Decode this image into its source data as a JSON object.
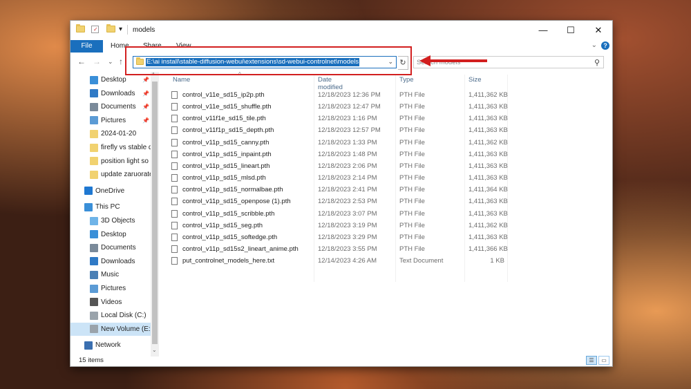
{
  "window": {
    "title": "models",
    "qat_dropdown": "▾",
    "controls": {
      "minimize": "—",
      "maximize": "☐",
      "close": "✕"
    }
  },
  "ribbon": {
    "file_label": "File",
    "tabs": [
      "Home",
      "Share",
      "View"
    ],
    "expand": "⌄",
    "help": "?"
  },
  "nav": {
    "back": "←",
    "forward": "→",
    "recent": "⌄",
    "up": "↑",
    "address": "E:\\ai install\\stable-diffusion-webui\\extensions\\sd-webui-controlnet\\models",
    "address_dropdown": "⌄",
    "refresh": "↻",
    "search_placeholder": "Search models",
    "search_icon": "⚲",
    "collapse": "^"
  },
  "sidebar": {
    "quick_access": [
      {
        "label": "Desktop",
        "icon": "desktop-icon",
        "pinned": true
      },
      {
        "label": "Downloads",
        "icon": "downloads-icon",
        "pinned": true
      },
      {
        "label": "Documents",
        "icon": "documents-icon",
        "pinned": true
      },
      {
        "label": "Pictures",
        "icon": "pictures-icon",
        "pinned": true
      },
      {
        "label": "2024-01-20",
        "icon": "folder-icon",
        "pinned": false
      },
      {
        "label": "firefly vs stable d",
        "icon": "folder-icon",
        "pinned": false
      },
      {
        "label": "position light so",
        "icon": "folder-icon",
        "pinned": false
      },
      {
        "label": "update zaruorate",
        "icon": "folder-icon",
        "pinned": false
      }
    ],
    "pin_glyph": "📌",
    "onedrive": "OneDrive",
    "this_pc": "This PC",
    "pc_items": [
      {
        "label": "3D Objects",
        "icon": "3d-objects-icon"
      },
      {
        "label": "Desktop",
        "icon": "desktop-icon"
      },
      {
        "label": "Documents",
        "icon": "documents-icon"
      },
      {
        "label": "Downloads",
        "icon": "downloads-icon"
      },
      {
        "label": "Music",
        "icon": "music-icon"
      },
      {
        "label": "Pictures",
        "icon": "pictures-icon"
      },
      {
        "label": "Videos",
        "icon": "videos-icon"
      },
      {
        "label": "Local Disk (C:)",
        "icon": "drive-icon"
      },
      {
        "label": "New Volume (E:)",
        "icon": "drive-icon",
        "selected": true
      }
    ],
    "network": "Network",
    "scroll_up": "^",
    "scroll_down": "⌄"
  },
  "list": {
    "columns": [
      "Name",
      "Date modified",
      "Type",
      "Size"
    ],
    "rows": [
      [
        "control_v11e_sd15_ip2p.pth",
        "12/18/2023 12:36 PM",
        "PTH File",
        "1,411,362 KB"
      ],
      [
        "control_v11e_sd15_shuffle.pth",
        "12/18/2023 12:47 PM",
        "PTH File",
        "1,411,363 KB"
      ],
      [
        "control_v11f1e_sd15_tile.pth",
        "12/18/2023 1:16 PM",
        "PTH File",
        "1,411,363 KB"
      ],
      [
        "control_v11f1p_sd15_depth.pth",
        "12/18/2023 12:57 PM",
        "PTH File",
        "1,411,363 KB"
      ],
      [
        "control_v11p_sd15_canny.pth",
        "12/18/2023 1:33 PM",
        "PTH File",
        "1,411,362 KB"
      ],
      [
        "control_v11p_sd15_inpaint.pth",
        "12/18/2023 1:48 PM",
        "PTH File",
        "1,411,363 KB"
      ],
      [
        "control_v11p_sd15_lineart.pth",
        "12/18/2023 2:06 PM",
        "PTH File",
        "1,411,363 KB"
      ],
      [
        "control_v11p_sd15_mlsd.pth",
        "12/18/2023 2:14 PM",
        "PTH File",
        "1,411,363 KB"
      ],
      [
        "control_v11p_sd15_normalbae.pth",
        "12/18/2023 2:41 PM",
        "PTH File",
        "1,411,364 KB"
      ],
      [
        "control_v11p_sd15_openpose (1).pth",
        "12/18/2023 2:53 PM",
        "PTH File",
        "1,411,363 KB"
      ],
      [
        "control_v11p_sd15_scribble.pth",
        "12/18/2023 3:07 PM",
        "PTH File",
        "1,411,363 KB"
      ],
      [
        "control_v11p_sd15_seg.pth",
        "12/18/2023 3:19 PM",
        "PTH File",
        "1,411,362 KB"
      ],
      [
        "control_v11p_sd15_softedge.pth",
        "12/18/2023 3:29 PM",
        "PTH File",
        "1,411,363 KB"
      ],
      [
        "control_v11p_sd15s2_lineart_anime.pth",
        "12/18/2023 3:55 PM",
        "PTH File",
        "1,411,366 KB"
      ],
      [
        "put_controlnet_models_here.txt",
        "12/14/2023 4:26 AM",
        "Text Document",
        "1 KB"
      ]
    ]
  },
  "status": {
    "count": "15 items",
    "details_view": "☰",
    "large_icons_view": "▭"
  },
  "colors": {
    "accent": "#1a6fbd",
    "selection": "#cce4f7",
    "annotation_red": "#d21f1f"
  }
}
